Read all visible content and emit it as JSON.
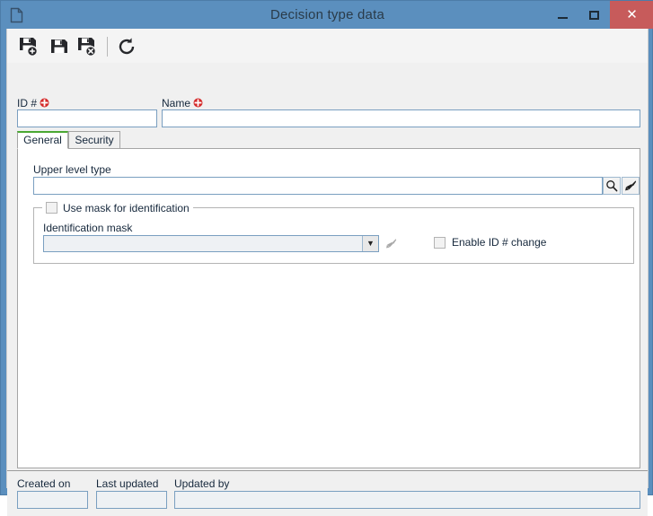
{
  "window": {
    "title": "Decision type data",
    "icon": "document-icon",
    "accent_titlebar": "#5b8fbe",
    "accent_close": "#c75b5b",
    "accent_active_tab": "#4aa832",
    "required_marker_color": "#d42a2a",
    "controls": {
      "minimize": "minimize-button",
      "maximize": "maximize-button",
      "close": "close-button",
      "close_glyph": "✕"
    }
  },
  "toolbar": {
    "buttons": [
      {
        "name": "save-new-button",
        "icon": "save-new-icon",
        "tooltip": "Save and new"
      },
      {
        "name": "save-button",
        "icon": "save-icon",
        "tooltip": "Save"
      },
      {
        "name": "save-close-button",
        "icon": "save-close-icon",
        "tooltip": "Save and close"
      },
      {
        "name": "refresh-button",
        "icon": "refresh-icon",
        "tooltip": "Refresh"
      }
    ]
  },
  "header": {
    "id_label": "ID #",
    "id_value": "",
    "id_required": true,
    "name_label": "Name",
    "name_value": "",
    "name_required": true
  },
  "tabs": [
    {
      "label": "General",
      "active": true
    },
    {
      "label": "Security",
      "active": false
    }
  ],
  "general": {
    "upper_level_type": {
      "label": "Upper level type",
      "value": "",
      "search_icon": "magnifier-icon",
      "clear_icon": "brush-icon"
    },
    "mask_group": {
      "title": "Use mask for identification",
      "checked": false,
      "identification_mask": {
        "label": "Identification mask",
        "value": "",
        "enabled": false,
        "arrow_glyph": "▼",
        "clear_icon": "brush-icon"
      },
      "enable_id_change": {
        "label": "Enable ID # change",
        "checked": false
      }
    }
  },
  "footer": {
    "created_on": {
      "label": "Created on",
      "value": ""
    },
    "last_updated": {
      "label": "Last updated",
      "value": ""
    },
    "updated_by": {
      "label": "Updated by",
      "value": ""
    }
  }
}
